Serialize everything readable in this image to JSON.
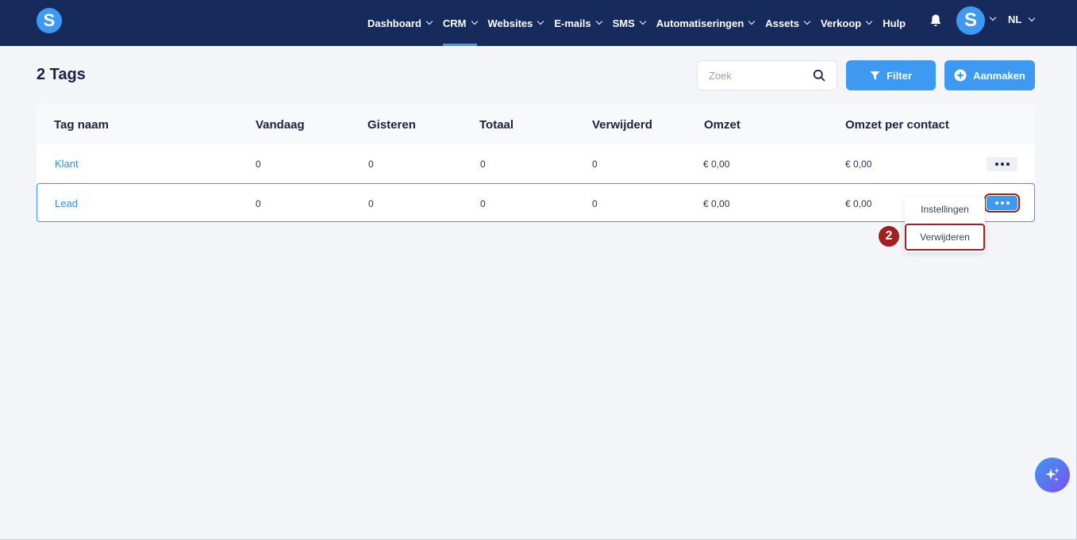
{
  "app": {
    "logo_letter": "S",
    "avatar_letter": "S",
    "language": "NL"
  },
  "nav": {
    "items": [
      {
        "label": "Dashboard",
        "has_chevron": true,
        "active": false
      },
      {
        "label": "CRM",
        "has_chevron": true,
        "active": true
      },
      {
        "label": "Websites",
        "has_chevron": true,
        "active": false
      },
      {
        "label": "E-mails",
        "has_chevron": true,
        "active": false
      },
      {
        "label": "SMS",
        "has_chevron": true,
        "active": false
      },
      {
        "label": "Automatiseringen",
        "has_chevron": true,
        "active": false
      },
      {
        "label": "Assets",
        "has_chevron": true,
        "active": false
      },
      {
        "label": "Verkoop",
        "has_chevron": true,
        "active": false
      },
      {
        "label": "Hulp",
        "has_chevron": false,
        "active": false
      }
    ]
  },
  "header": {
    "title": "2 Tags",
    "search_placeholder": "Zoek",
    "filter_label": "Filter",
    "create_label": "Aanmaken"
  },
  "table": {
    "columns": [
      "Tag naam",
      "Vandaag",
      "Gisteren",
      "Totaal",
      "Verwijderd",
      "Omzet",
      "Omzet per contact"
    ],
    "rows": [
      {
        "name": "Klant",
        "today": "0",
        "yesterday": "0",
        "total": "0",
        "deleted": "0",
        "revenue": "€ 0,00",
        "revenue_per_contact": "€ 0,00"
      },
      {
        "name": "Lead",
        "today": "0",
        "yesterday": "0",
        "total": "0",
        "deleted": "0",
        "revenue": "€ 0,00",
        "revenue_per_contact": "€ 0,00"
      }
    ]
  },
  "row_menu": {
    "items": [
      "Instellingen",
      "Verwijderen"
    ]
  },
  "annotation": {
    "step": "2"
  },
  "colors": {
    "topbar": "#162a5c",
    "accent": "#3d9af0",
    "highlight": "#a31e1e",
    "background": "#f3f5f9"
  },
  "icons": {
    "bell": "bell-icon",
    "search": "search-icon",
    "filter": "filter-icon",
    "create": "plus-circle-icon",
    "more": "ellipsis-icon",
    "assistant": "sparkle-icon"
  }
}
